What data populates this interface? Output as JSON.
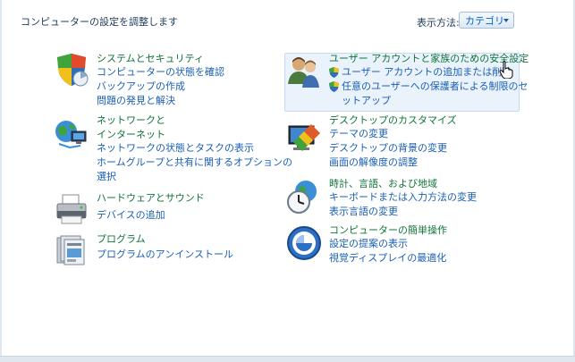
{
  "header": {
    "title": "コンピューターの設定を調整します",
    "view_by_label": "表示方法:",
    "view_by_value": "カテゴリ"
  },
  "categories": [
    {
      "id": "system-security",
      "title": "システムとセキュリティ",
      "icon": "shield-icon",
      "links": [
        "コンピューターの状態を確認",
        "バックアップの作成",
        "問題の発見と解決"
      ]
    },
    {
      "id": "network",
      "title_line1": "ネットワークと",
      "title_line2": "インターネット",
      "icon": "network-globe-icon",
      "links": [
        "ネットワークの状態とタスクの表示",
        "ホームグループと共有に関するオプションの",
        "選択"
      ]
    },
    {
      "id": "hardware",
      "title": "ハードウェアとサウンド",
      "icon": "printer-icon",
      "links": [
        "デバイスの追加"
      ]
    },
    {
      "id": "programs",
      "title": "プログラム",
      "icon": "programs-icon",
      "links": [
        "プログラムのアンインストール"
      ]
    },
    {
      "id": "user-accounts",
      "title": "ユーザー アカウントと家族のための安全設定",
      "icon": "users-icon",
      "links": [
        "ユーザー アカウントの追加または削除",
        "任意のユーザーへの保護者による制限のセ",
        "ットアップ"
      ]
    },
    {
      "id": "appearance",
      "title": "デスクトップのカスタマイズ",
      "icon": "display-paint-icon",
      "links": [
        "テーマの変更",
        "デスクトップの背景の変更",
        "画面の解像度の調整"
      ]
    },
    {
      "id": "clock-region",
      "title": "時計、言語、および地域",
      "icon": "clock-globe-icon",
      "links": [
        "キーボードまたは入力方法の変更",
        "表示言語の変更"
      ]
    },
    {
      "id": "ease-of-access",
      "title": "コンピューターの簡単操作",
      "icon": "ease-of-access-icon",
      "links": [
        "設定の提案の表示",
        "視覚ディスプレイの最適化"
      ]
    }
  ]
}
